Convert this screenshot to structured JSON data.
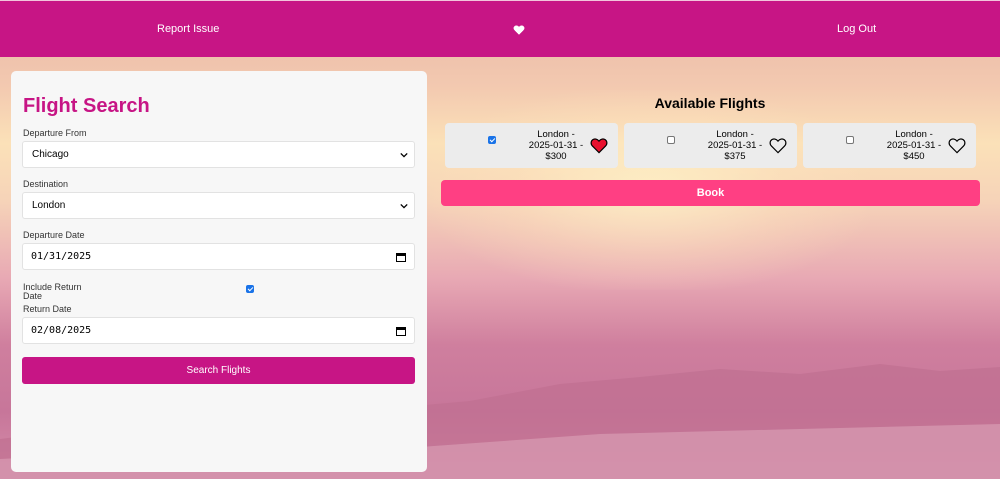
{
  "nav": {
    "report_label": "Report Issue",
    "heart_icon": "heart-icon",
    "logout_label": "Log Out"
  },
  "search": {
    "title": "Flight Search",
    "departure_label": "Departure From",
    "departure_value": "Chicago",
    "destination_label": "Destination",
    "destination_value": "London",
    "departure_date_label": "Departure Date",
    "departure_date_value": "01/31/2025",
    "return_toggle_label": "Include Return Date",
    "return_toggle_checked": true,
    "return_date_label": "Return Date",
    "return_date_value": "02/08/2025",
    "search_button": "Search Flights"
  },
  "results": {
    "title": "Available Flights",
    "flights": [
      {
        "line1": "London -",
        "line2": "2025-01-31 -",
        "line3": "$300",
        "selected": true,
        "favorite": true
      },
      {
        "line1": "London -",
        "line2": "2025-01-31 -",
        "line3": "$375",
        "selected": false,
        "favorite": false
      },
      {
        "line1": "London -",
        "line2": "2025-01-31 -",
        "line3": "$450",
        "selected": false,
        "favorite": false
      }
    ],
    "book_button": "Book"
  },
  "colors": {
    "brand": "#c71585",
    "book": "#ff3f83",
    "favorite": "#e8102e"
  }
}
